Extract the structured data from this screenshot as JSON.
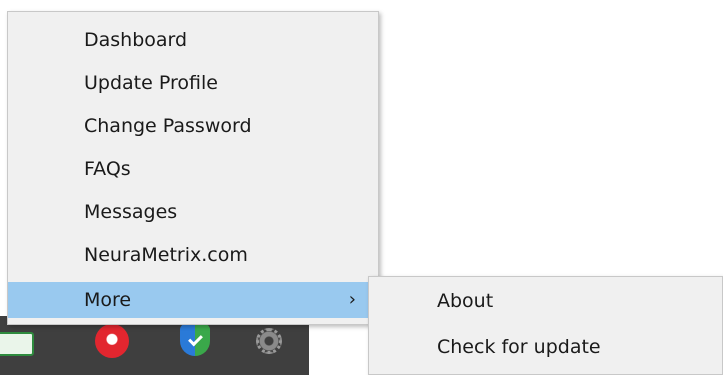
{
  "menu": {
    "items": [
      {
        "label": "Dashboard"
      },
      {
        "label": "Update Profile"
      },
      {
        "label": "Change Password"
      },
      {
        "label": "FAQs"
      },
      {
        "label": "Messages"
      },
      {
        "label": "NeuraMetrix.com"
      },
      {
        "label": "More",
        "has_submenu": true,
        "highlighted": true,
        "arrow": "›"
      }
    ]
  },
  "submenu": {
    "items": [
      {
        "label": "About"
      },
      {
        "label": "Check for update"
      }
    ]
  },
  "taskbar": {
    "icons": [
      "tray-app-icon",
      "red-record-icon",
      "security-shield-icon",
      "gear-icon"
    ]
  },
  "colors": {
    "menu_background": "#f0f0f0",
    "highlight": "#99c9ef",
    "taskbar": "#3f3f3f"
  }
}
